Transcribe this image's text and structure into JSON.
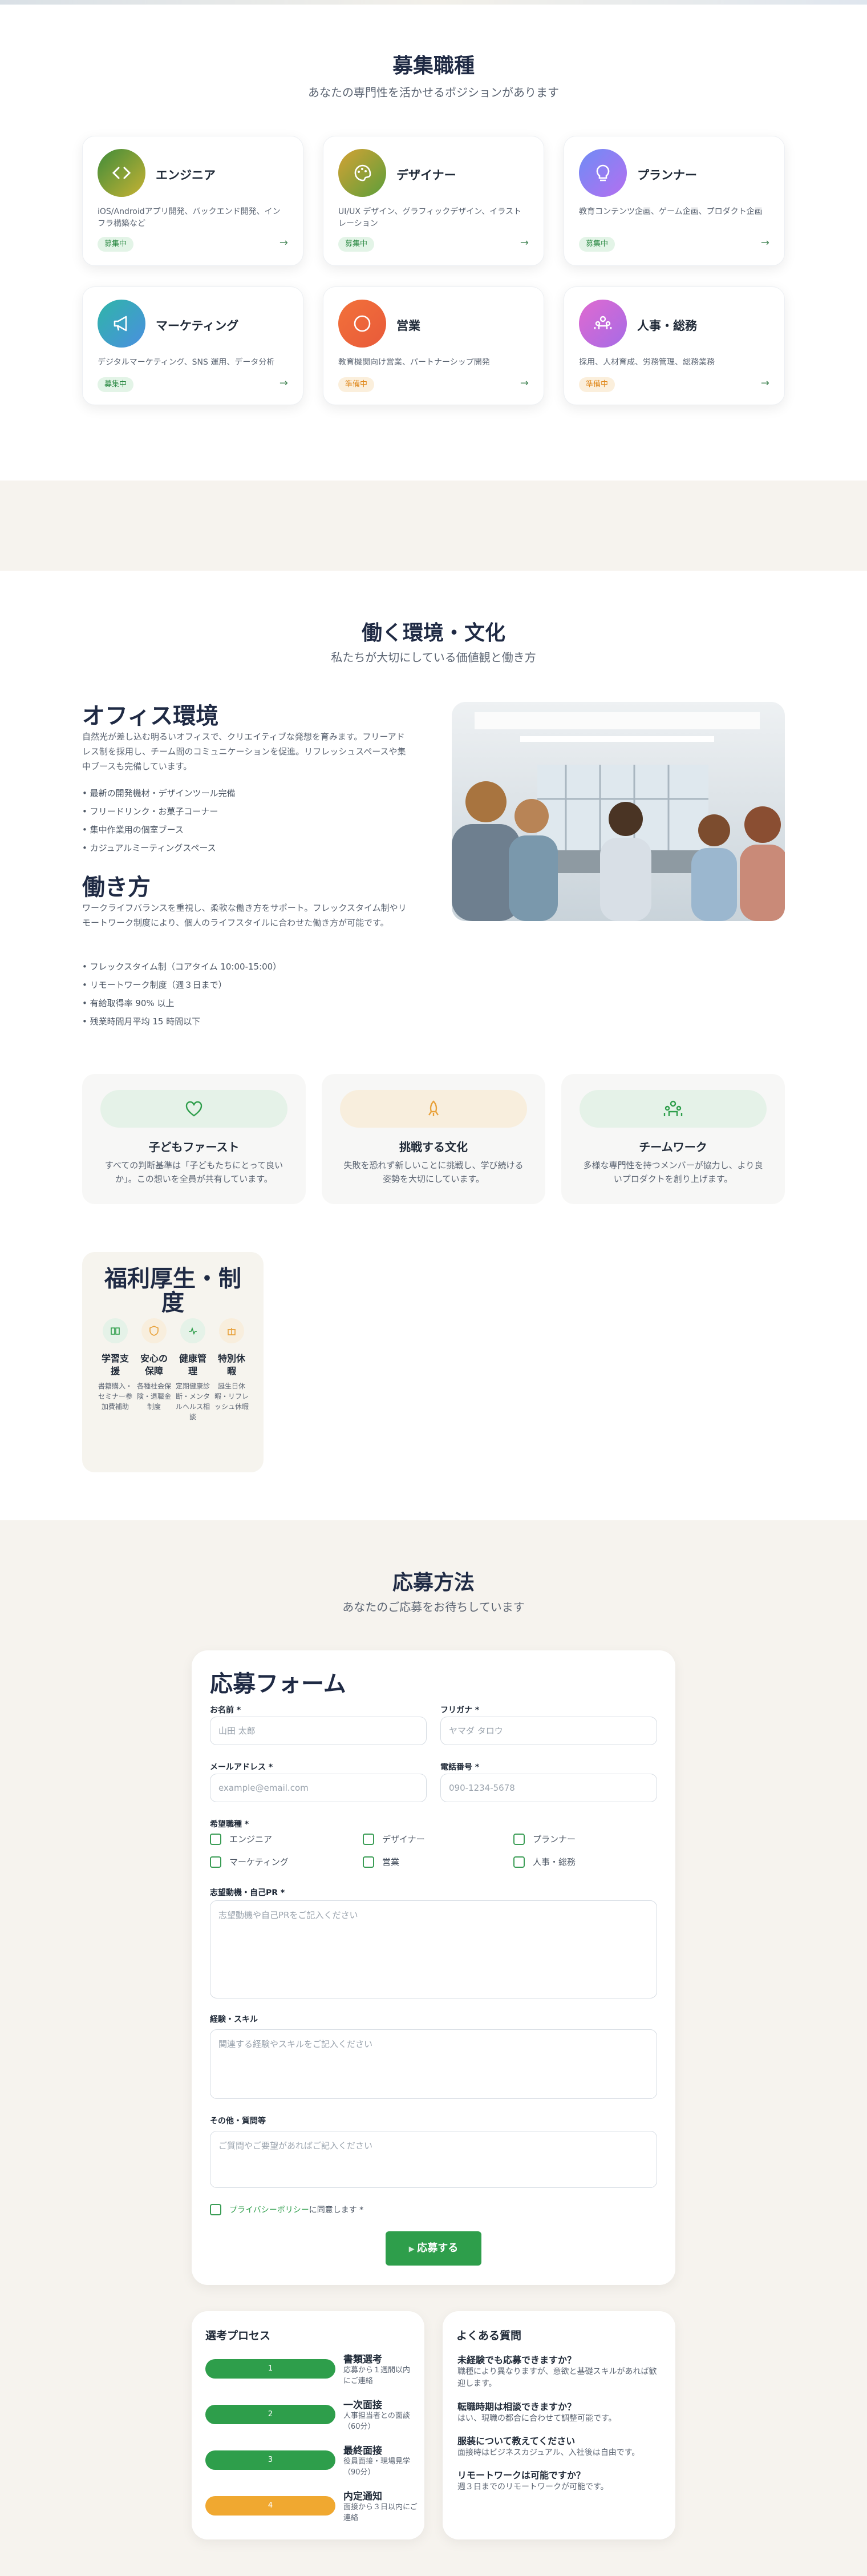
{
  "positions": {
    "title": "募集職種",
    "subtitle": "あなたの専門性を活かせるポジションがあります",
    "items": [
      {
        "name": "エンジニア",
        "desc": "iOS/Androidアプリ開発、バックエンド開発、インフラ構築など",
        "status": "募集中",
        "icon": "code-icon",
        "color": "#5a9a3c"
      },
      {
        "name": "デザイナー",
        "desc": "UI/UX デザイン、グラフィックデザイン、イラストレーション",
        "status": "募集中",
        "icon": "palette-icon",
        "color": "#b9a832"
      },
      {
        "name": "プランナー",
        "desc": "教育コンテンツ企画、ゲーム企画、プロダクト企画",
        "status": "募集中",
        "icon": "lightbulb-icon",
        "color": "#7d7cf0"
      },
      {
        "name": "マーケティング",
        "desc": "デジタルマーケティング、SNS 運用、データ分析",
        "status": "募集中",
        "icon": "megaphone-icon",
        "color": "#2fb5a8"
      },
      {
        "name": "営業",
        "desc": "教育機関向け営業、パートナーシップ開発",
        "status": "準備中",
        "icon": "circle-icon",
        "color": "#ef6a3a"
      },
      {
        "name": "人事・総務",
        "desc": "採用、人材育成、労務管理、総務業務",
        "status": "準備中",
        "icon": "people-icon",
        "color": "#c76be0"
      }
    ]
  },
  "culture": {
    "title": "働く環境・文化",
    "subtitle": "私たちが大切にしている価値観と働き方",
    "office": {
      "heading": "オフィス環境",
      "text": "自然光が差し込む明るいオフィスで、クリエイティブな発想を育みます。フリーアドレス制を採用し、チーム間のコミュニケーションを促進。リフレッシュスペースや集中ブースも完備しています。",
      "list": [
        "最新の開発機材・デザインツール完備",
        "フリードリンク・お菓子コーナー",
        "集中作業用の個室ブース",
        "カジュアルミーティングスペース"
      ]
    },
    "workstyle": {
      "heading": "働き方",
      "text": "ワークライフバランスを重視し、柔軟な働き方をサポート。フレックスタイム制やリモートワーク制度により、個人のライフスタイルに合わせた働き方が可能です。",
      "list": [
        "フレックスタイム制（コアタイム 10:00-15:00）",
        "リモートワーク制度（週３日まで）",
        "有給取得率 90% 以上",
        "残業時間月平均 15 時間以下"
      ]
    },
    "values": [
      {
        "title": "子どもファースト",
        "text": "すべての判断基準は「子どもたちにとって良いか」。この想いを全員が共有しています。",
        "icon": "heart-icon",
        "bg": "#e5f2e8"
      },
      {
        "title": "挑戦する文化",
        "text": "失敗を恐れず新しいことに挑戦し、学び続ける姿勢を大切にしています。",
        "icon": "rocket-icon",
        "bg": "#f8eedd"
      },
      {
        "title": "チームワーク",
        "text": "多様な専門性を持つメンバーが協力し、より良いプロダクトを創り上げます。",
        "icon": "team-icon",
        "bg": "#e5f2e8"
      }
    ],
    "benefits": {
      "title": "福利厚生・制度",
      "items": [
        {
          "head": "学習支援",
          "text": "書籍購入・セミナー参加費補助",
          "bg": "#e5f2e8"
        },
        {
          "head": "安心の保障",
          "text": "各種社会保険・退職金制度",
          "bg": "#f8eedd"
        },
        {
          "head": "健康管理",
          "text": "定期健康診断・メンタルヘルス相談",
          "bg": "#e5f2e8"
        },
        {
          "head": "特別休暇",
          "text": "誕生日休暇・リフレッシュ休暇",
          "bg": "#f8eedd"
        }
      ]
    }
  },
  "apply": {
    "title": "応募方法",
    "subtitle": "あなたのご応募をお待ちしています",
    "form": {
      "heading": "応募フォーム",
      "name_label": "お名前 *",
      "name_placeholder": "山田 太郎",
      "kana_label": "フリガナ *",
      "kana_placeholder": "ヤマダ タロウ",
      "email_label": "メールアドレス *",
      "email_placeholder": "example@email.com",
      "phone_label": "電話番号 *",
      "phone_placeholder": "090-1234-5678",
      "job_label": "希望職種 *",
      "jobs": [
        "エンジニア",
        "デザイナー",
        "プランナー",
        "マーケティング",
        "営業",
        "人事・総務"
      ],
      "pr_label": "志望動機・自己PR *",
      "pr_placeholder": "志望動機や自己PRをご記入ください",
      "skill_label": "経験・スキル",
      "skill_placeholder": "関連する経験やスキルをご記入ください",
      "other_label": "その他・質問等",
      "other_placeholder": "ご質問やご要望があればご記入ください",
      "privacy_link": "プライバシーポリシー",
      "privacy_suffix": "に同意します *",
      "submit": "応募する"
    },
    "process": {
      "title": "選考プロセス",
      "steps": [
        {
          "num": "1",
          "title": "書類選考",
          "desc": "応募から１週間以内にご連絡",
          "color": "#2e9e4b"
        },
        {
          "num": "2",
          "title": "一次面接",
          "desc": "人事担当者との面談（60分）",
          "color": "#2e9e4b"
        },
        {
          "num": "3",
          "title": "最終面接",
          "desc": "役員面接・現場見学（90分）",
          "color": "#2e9e4b"
        },
        {
          "num": "4",
          "title": "内定通知",
          "desc": "面接から３日以内にご連絡",
          "color": "#f0a830"
        }
      ]
    },
    "faq": {
      "title": "よくある質問",
      "items": [
        {
          "q": "未経験でも応募できますか？",
          "a": "職種により異なりますが、意欲と基礎スキルがあれば歓迎します。"
        },
        {
          "q": "転職時期は相談できますか？",
          "a": "はい、現職の都合に合わせて調整可能です。"
        },
        {
          "q": "服装について教えてください",
          "a": "面接時はビジネスカジュアル、入社後は自由です。"
        },
        {
          "q": "リモートワークは可能ですか？",
          "a": "週３日までのリモートワークが可能です。"
        }
      ]
    }
  }
}
